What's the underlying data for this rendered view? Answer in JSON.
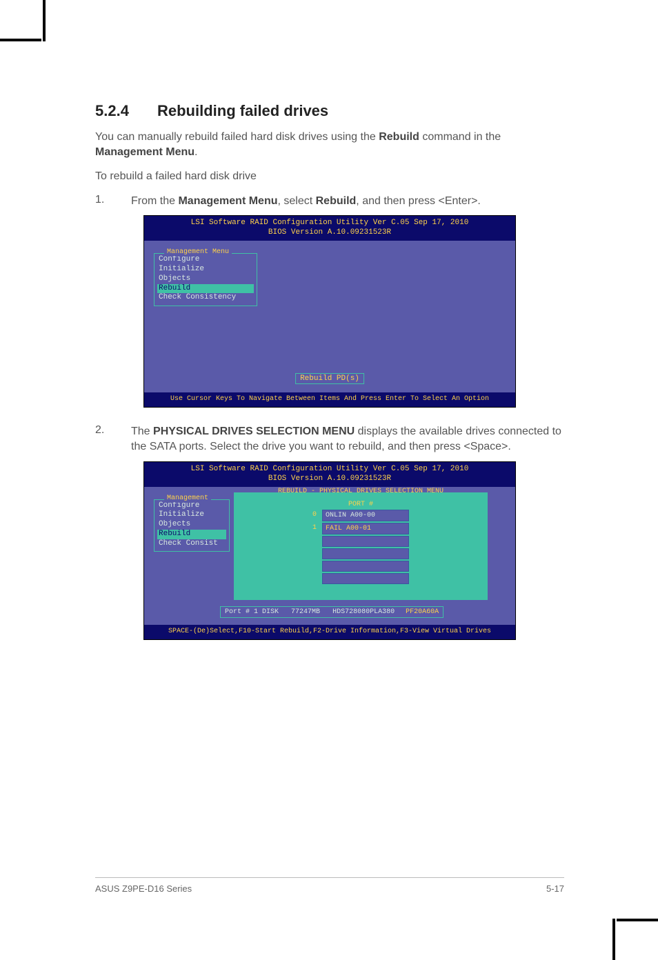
{
  "section": {
    "number": "5.2.4",
    "title": "Rebuilding failed drives"
  },
  "intro": {
    "pre": "You can manually rebuild failed hard disk drives using the ",
    "bold1": "Rebuild",
    "mid": " command in the ",
    "bold2": "Management Menu",
    "post": "."
  },
  "lead": "To rebuild a failed hard disk drive",
  "step1": {
    "num": "1.",
    "pre": "From the ",
    "bold1": "Management Menu",
    "mid": ", select ",
    "bold2": "Rebuild",
    "post": ", and then press <Enter>."
  },
  "step2": {
    "num": "2.",
    "pre": "The ",
    "bold1": "PHYSICAL DRIVES SELECTION MENU",
    "post": " displays the available drives connected to the SATA ports. Select the drive you want to rebuild, and then press <Space>."
  },
  "bios": {
    "title": "LSI Software RAID Configuration Utility Ver C.05 Sep 17, 2010",
    "subtitle": "BIOS Version   A.10.09231523R",
    "menu_title": "Management Menu",
    "menu_title_short": "Management",
    "items": {
      "configure": "Configure",
      "initialize": "Initialize",
      "objects": "Objects",
      "rebuild": "Rebuild",
      "check": "Check Consistency",
      "check_short": "Check Consist"
    },
    "rebuild_tag": "Rebuild PD(s)",
    "footer1": "Use Cursor Keys To Navigate Between Items And Press Enter To Select An Option",
    "panel_title": "REBUILD - PHYSICAL DRIVES SELECTION MENU",
    "port_header": "PORT #",
    "drives": [
      {
        "idx": "0",
        "label": "ONLIN A00-00"
      },
      {
        "idx": "1",
        "label": "FAIL  A00-01"
      }
    ],
    "info_row": {
      "port": "Port # 1 DISK",
      "size": "77247MB",
      "model": "HDS728080PLA380",
      "fw": "PF20A60A"
    },
    "footer2": "SPACE-(De)Select,F10-Start Rebuild,F2-Drive Information,F3-View Virtual Drives"
  },
  "footer": {
    "left": "ASUS Z9PE-D16 Series",
    "right": "5-17"
  }
}
